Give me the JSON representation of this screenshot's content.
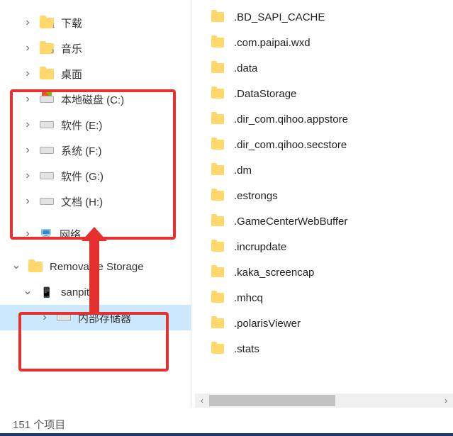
{
  "tree": {
    "downloads": "下载",
    "music": "音乐",
    "desktop": "桌面",
    "drive_c": "本地磁盘 (C:)",
    "drive_e": "软件 (E:)",
    "drive_f": "系统 (F:)",
    "drive_g": "软件 (G:)",
    "drive_h": "文档 (H:)",
    "network": "网络",
    "removable": "Removable Storage",
    "device": "sanpitt",
    "internal_storage": "内部存储器"
  },
  "files": [
    ".BD_SAPI_CACHE",
    ".com.paipai.wxd",
    ".data",
    ".DataStorage",
    ".dir_com.qihoo.appstore",
    ".dir_com.qihoo.secstore",
    ".dm",
    ".estrongs",
    ".GameCenterWebBuffer",
    ".incrupdate",
    ".kaka_screencap",
    ".mhcq",
    ".polarisViewer",
    ".stats"
  ],
  "status": "151 个项目"
}
